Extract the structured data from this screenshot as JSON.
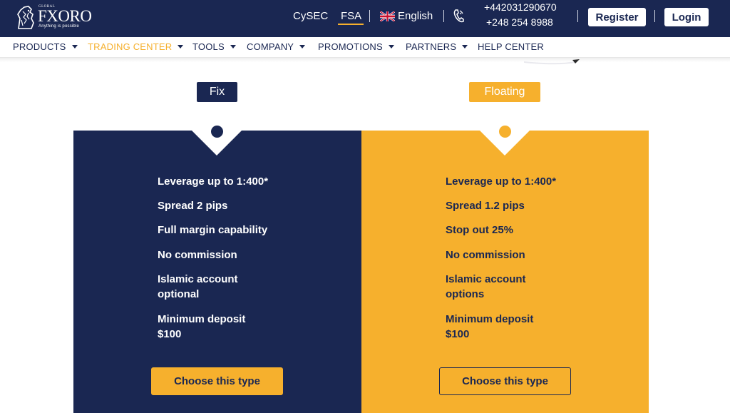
{
  "header": {
    "logo": {
      "small": "GLOBAL",
      "word": "FXORO",
      "tagline": "Anything is possible"
    },
    "regulators": [
      "CySEC",
      "FSA"
    ],
    "language": "English",
    "phones": [
      "+442031290670",
      "+248 254 8988"
    ],
    "register_label": "Register",
    "login_label": "Login"
  },
  "nav": {
    "items": [
      {
        "label": "PRODUCTS"
      },
      {
        "label": "TRADING CENTER"
      },
      {
        "label": "TOOLS"
      },
      {
        "label": "COMPANY"
      },
      {
        "label": "PROMOTIONS"
      },
      {
        "label": "PARTNERS"
      },
      {
        "label": "HELP CENTER"
      }
    ]
  },
  "plans": [
    {
      "label": "Fix",
      "features": [
        "Leverage up to 1:400*",
        "Spread 2 pips",
        "Full margin capability",
        "No commission",
        "Islamic account",
        "optional",
        "Minimum deposit",
        "$100"
      ],
      "button": "Choose this type"
    },
    {
      "label": "Floating",
      "features": [
        "Leverage up to 1:400*",
        "Spread 1.2 pips",
        "Stop out 25%",
        "No commission",
        "Islamic account",
        "options",
        "Minimum deposit",
        "$100"
      ],
      "button": "Choose this type"
    }
  ],
  "colors": {
    "navy": "#1a2752",
    "gold": "#f6b02d",
    "white": "#ffffff"
  },
  "icons": [
    "lion-logo-icon",
    "uk-flag-icon",
    "phone-icon",
    "caret-down-icon"
  ]
}
